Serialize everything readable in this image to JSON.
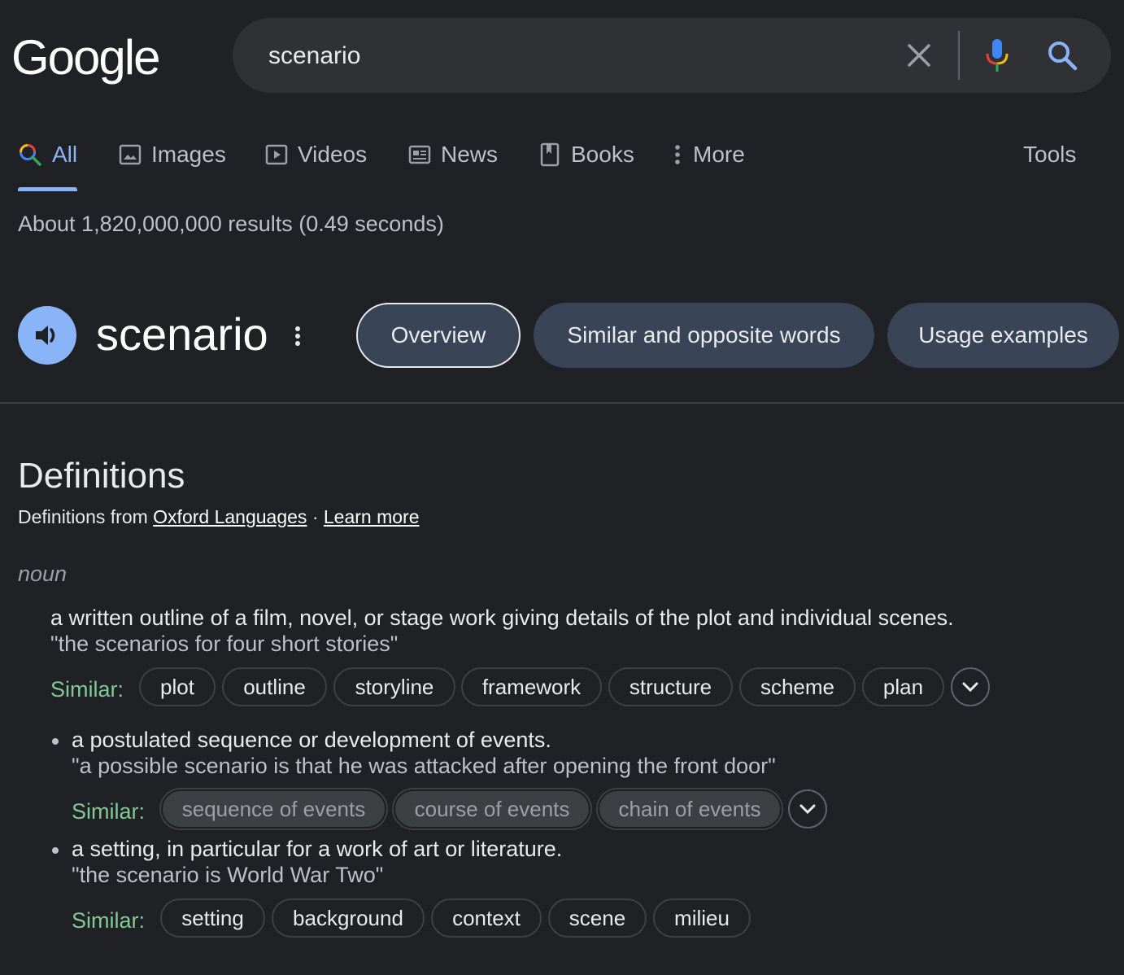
{
  "logo": "Google",
  "search": {
    "query": "scenario"
  },
  "tabs": [
    {
      "label": "All",
      "icon": "search-icon"
    },
    {
      "label": "Images",
      "icon": "image-icon"
    },
    {
      "label": "Videos",
      "icon": "play-icon"
    },
    {
      "label": "News",
      "icon": "news-icon"
    },
    {
      "label": "Books",
      "icon": "book-icon"
    },
    {
      "label": "More",
      "icon": "more-vert-icon"
    }
  ],
  "tools_label": "Tools",
  "stats": "About 1,820,000,000 results (0.49 seconds)",
  "dictionary": {
    "word": "scenario",
    "chips": [
      "Overview",
      "Similar and opposite words",
      "Usage examples"
    ],
    "definitions_title": "Definitions",
    "from_prefix": "Definitions from",
    "source_link": "Oxford Languages",
    "separator": "·",
    "learn_more": "Learn more",
    "pos": "noun",
    "similar_label": "Similar:",
    "senses": [
      {
        "text": "a written outline of a film, novel, or stage work giving details of the plot and individual scenes.",
        "example": "\"the scenarios for four short stories\"",
        "similar": [
          "plot",
          "outline",
          "storyline",
          "framework",
          "structure",
          "scheme",
          "plan"
        ]
      },
      {
        "text": "a postulated sequence or development of events.",
        "example": "\"a possible scenario is that he was attacked after opening the front door\"",
        "similar": [
          "sequence of events",
          "course of events",
          "chain of events"
        ]
      },
      {
        "text": "a setting, in particular for a work of art or literature.",
        "example": "\"the scenario is World War Two\"",
        "similar": [
          "setting",
          "background",
          "context",
          "scene",
          "milieu"
        ]
      }
    ]
  },
  "colors": {
    "background": "#202124",
    "accent": "#8ab4f8",
    "similar_green": "#81c995",
    "chip_bg": "#394457"
  }
}
